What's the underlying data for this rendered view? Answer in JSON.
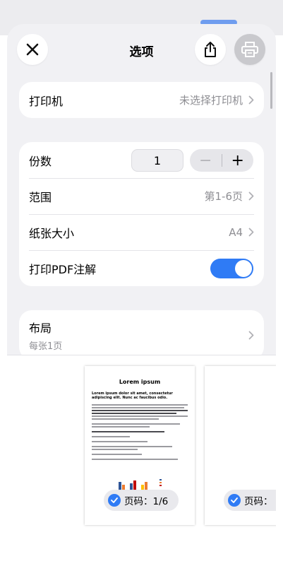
{
  "header": {
    "title": "选项",
    "close_icon": "close-icon",
    "share_icon": "share-icon",
    "print_icon": "printer-icon"
  },
  "printer": {
    "label": "打印机",
    "value": "未选择打印机"
  },
  "settings": {
    "copies_label": "份数",
    "copies_value": "1",
    "minus_label": "−",
    "plus_label": "+",
    "range_label": "范围",
    "range_value": "第1-6页",
    "paper_label": "纸张大小",
    "paper_value": "A4",
    "annotations_label": "打印PDF注解",
    "annotations_on": true
  },
  "layout": {
    "label": "布局",
    "value": "每张1页"
  },
  "preview": {
    "doc_title": "Lorem ipsum",
    "doc_subtitle": "Lorem ipsum dolor sit amet, consectetur adipiscing elit. Nunc ac faucibus odio.",
    "page_badge_1": "页码：1/6",
    "page_badge_2": "页码：",
    "chart_colors": [
      "#2f5597",
      "#ed7d31",
      "#ffc000",
      "#c00000"
    ]
  },
  "colors": {
    "accent": "#2f7bf5",
    "sheet": "#f1f1f4",
    "secondary_text": "#8e8e93"
  }
}
